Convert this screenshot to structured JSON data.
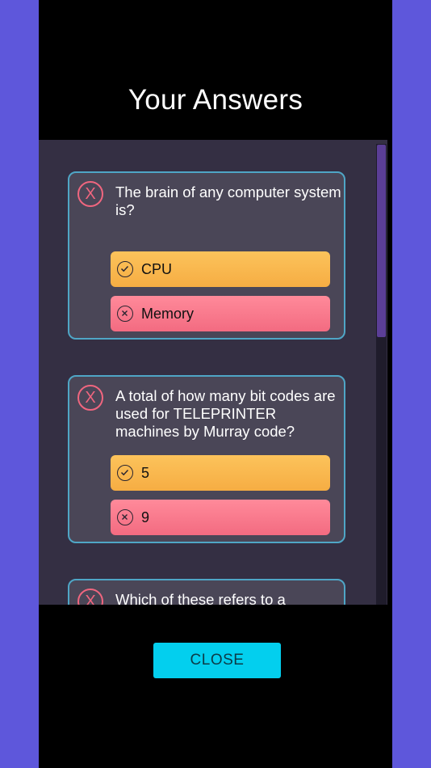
{
  "title": "Your Answers",
  "close_label": "CLOSE",
  "wrong_mark": "X",
  "colors": {
    "background": "#5e57db",
    "card_border": "#4fa6c6",
    "correct": "#f8b54b",
    "wrong": "#f77a8d",
    "close_button": "#03cfee"
  },
  "questions": [
    {
      "question": "The brain of any computer system is?",
      "correct_answer": "CPU",
      "your_answer": "Memory"
    },
    {
      "question": "A total of how many bit codes are used for TELEPRINTER machines by Murray code?",
      "correct_answer": "5",
      "your_answer": "9"
    },
    {
      "question": "Which of these refers to a systems"
    }
  ]
}
